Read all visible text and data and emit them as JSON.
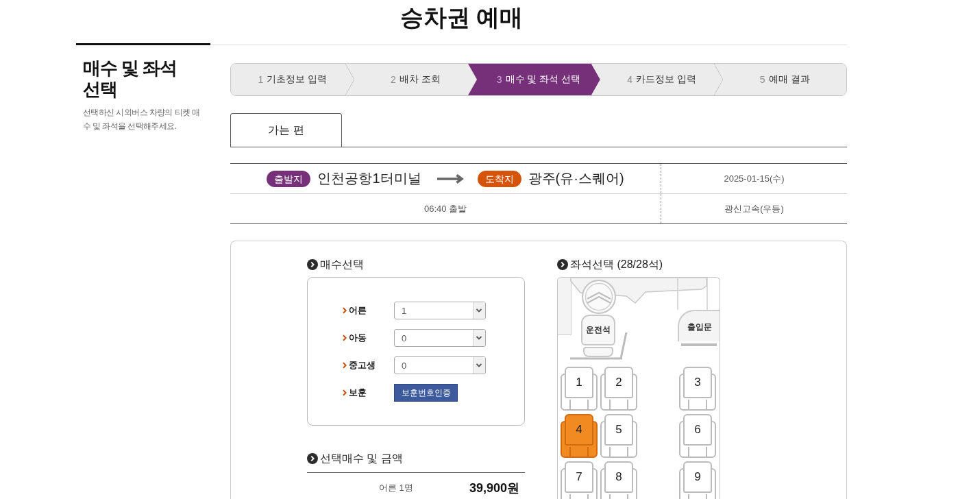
{
  "page": {
    "title": "승차권 예매"
  },
  "section": {
    "heading": "매수 및 좌석 선택",
    "description": "선택하신 시외버스 차량의 티켓 매수 및 좌석을 선택해주세요."
  },
  "steps": [
    {
      "number": "1",
      "label": "기초정보 입력",
      "selected": false
    },
    {
      "number": "2",
      "label": "배차 조회",
      "selected": false
    },
    {
      "number": "3",
      "label": "매수 및 좌석 선택",
      "selected": true
    },
    {
      "number": "4",
      "label": "카드정보 입력",
      "selected": false
    },
    {
      "number": "5",
      "label": "예매 결과",
      "selected": false
    }
  ],
  "tabs": [
    {
      "label": "가는 편",
      "selected": true
    }
  ],
  "route": {
    "departure_badge": "출발지",
    "departure": "인천공항1터미널",
    "arrival_badge": "도착지",
    "arrival": "광주(유·스퀘어)",
    "date": "2025-01-15(수)",
    "departure_time": "06:40 출발",
    "operator": "광신고속(우등)"
  },
  "ticket_count": {
    "title": "매수선택",
    "rows": [
      {
        "kind": "select",
        "label": "어른",
        "value": "1"
      },
      {
        "kind": "select",
        "label": "아동",
        "value": "0"
      },
      {
        "kind": "select",
        "label": "중고생",
        "value": "0"
      },
      {
        "kind": "button",
        "label": "보훈",
        "button": "보훈번호인증"
      }
    ]
  },
  "summary": {
    "title": "선택매수 및 금액",
    "items": [
      {
        "label": "어른 1명",
        "amount": "39,900원"
      }
    ]
  },
  "seat_map": {
    "title": "좌석선택 (28/28석)",
    "driver_label": "운전석",
    "door_label": "출입문",
    "seats": [
      {
        "number": "1",
        "selected": false
      },
      {
        "number": "2",
        "selected": false
      },
      {
        "number": "3",
        "selected": false
      },
      {
        "number": "4",
        "selected": true
      },
      {
        "number": "5",
        "selected": false
      },
      {
        "number": "6",
        "selected": false
      },
      {
        "number": "7",
        "selected": false
      },
      {
        "number": "8",
        "selected": false
      },
      {
        "number": "9",
        "selected": false
      }
    ]
  }
}
